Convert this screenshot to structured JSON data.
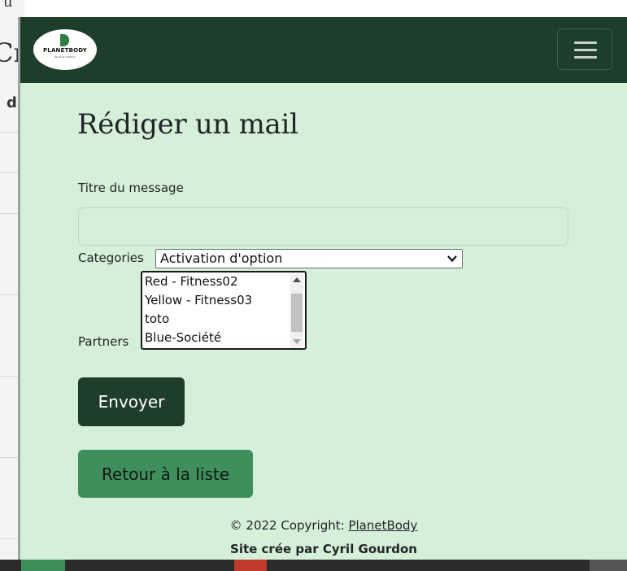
{
  "background_page": {
    "glyphs": [
      "u",
      "Cr",
      "d"
    ]
  },
  "navbar": {
    "logo_text": "PLANETBODY",
    "logo_tagline": "Sport et nutrition",
    "colors": {
      "bar": "#1e3d2b",
      "logo_mark": "#2f7d45"
    }
  },
  "page": {
    "title": "Rédiger un mail",
    "background": "#d5efd8"
  },
  "form": {
    "message_title_label": "Titre du message",
    "message_title_value": "",
    "categories_label": "Categories",
    "categories_selected": "Activation d'option",
    "partners_label": "Partners",
    "partners_options": [
      "Red - Fitness02",
      "Yellow - Fitness03",
      "toto",
      "Blue-Société"
    ]
  },
  "buttons": {
    "send_label": "Envoyer",
    "back_label": "Retour à la liste",
    "send_color": "#1e3d2b",
    "back_color": "#3f8f5d"
  },
  "footer": {
    "copyright_prefix": "© 2022 Copyright: ",
    "copyright_link": "PlanetBody",
    "credit": "Site crée par Cyril Gourdon"
  }
}
